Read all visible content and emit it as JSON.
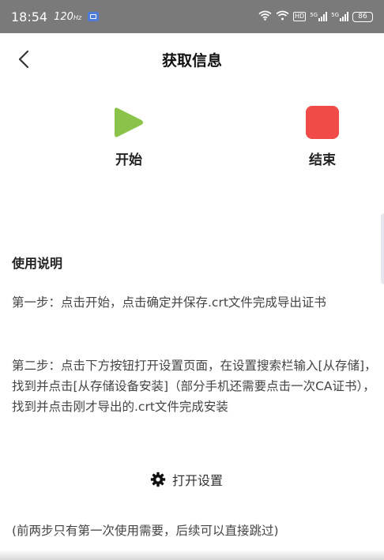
{
  "status_bar": {
    "time": "18:54",
    "refresh_rate": "120",
    "refresh_unit": "Hz",
    "network_label_1": "5G",
    "network_label_2": "5G",
    "battery": "86"
  },
  "nav": {
    "title": "获取信息"
  },
  "actions": {
    "start_label": "开始",
    "end_label": "结束",
    "start_color": "#8bc34a",
    "end_color": "#f04b47"
  },
  "instructions": {
    "title": "使用说明",
    "step1": "第一步：点击开始，点击确定并保存.crt文件完成导出证书",
    "step2": "第二步：点击下方按钮打开设置页面，在设置搜索栏输入[从存储]，找到并点击[从存储设备安装]（部分手机还需要点击一次CA证书），找到并点击刚才导出的.crt文件完成安装"
  },
  "settings_button": {
    "label": "打开设置"
  },
  "footnote": "(前两步只有第一次使用需要，后续可以直接跳过)"
}
